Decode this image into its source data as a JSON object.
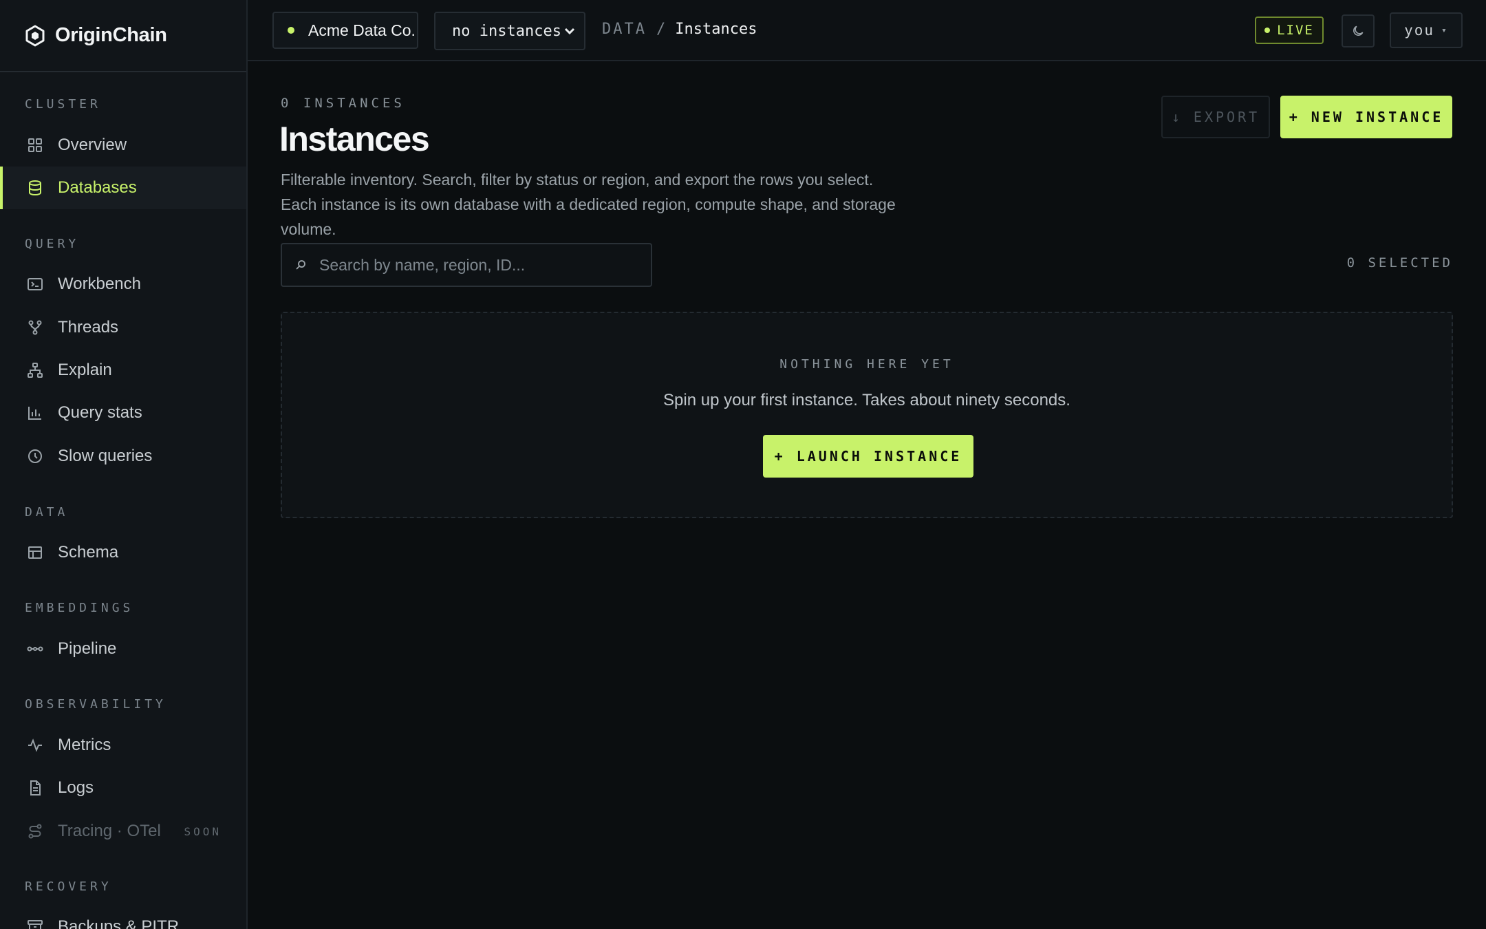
{
  "app": {
    "name": "OriginChain"
  },
  "colors": {
    "accent": "#c8f26a",
    "background": "#0b0e10",
    "sidebar": "#111519"
  },
  "sidebar": {
    "sections": [
      {
        "label": "CLUSTER",
        "items": [
          {
            "label": "Overview",
            "icon": "grid-icon"
          },
          {
            "label": "Databases",
            "icon": "database-icon",
            "active": true
          }
        ]
      },
      {
        "label": "QUERY",
        "items": [
          {
            "label": "Workbench",
            "icon": "terminal-icon"
          },
          {
            "label": "Threads",
            "icon": "branch-icon"
          },
          {
            "label": "Explain",
            "icon": "tree-icon"
          },
          {
            "label": "Query stats",
            "icon": "bar-chart-icon"
          },
          {
            "label": "Slow queries",
            "icon": "clock-icon"
          }
        ]
      },
      {
        "label": "DATA",
        "items": [
          {
            "label": "Schema",
            "icon": "table-icon"
          }
        ]
      },
      {
        "label": "EMBEDDINGS",
        "items": [
          {
            "label": "Pipeline",
            "icon": "pipeline-icon"
          }
        ]
      },
      {
        "label": "OBSERVABILITY",
        "items": [
          {
            "label": "Metrics",
            "icon": "pulse-icon"
          },
          {
            "label": "Logs",
            "icon": "document-icon"
          },
          {
            "label": "Tracing · OTel",
            "icon": "route-icon",
            "badge": "SOON",
            "disabled": true
          }
        ]
      },
      {
        "label": "RECOVERY",
        "items": [
          {
            "label": "Backups & PITR",
            "icon": "archive-icon"
          }
        ]
      }
    ]
  },
  "topbar": {
    "org": "Acme Data Co.",
    "instance_select": "no instances",
    "breadcrumb": [
      "DATA",
      "Instances"
    ],
    "breadcrumb_separator": "/",
    "live": "LIVE",
    "user": "you",
    "user_caret": "▾"
  },
  "page": {
    "count_label": "0 INSTANCES",
    "title": "Instances",
    "description": "Filterable inventory. Search, filter by status or region, and export the rows you select. Each instance is its own database with a dedicated region, compute shape, and storage volume.",
    "export_label": "↓ EXPORT",
    "new_label": "+ NEW INSTANCE",
    "search_placeholder": "Search by name, region, ID...",
    "selected_label": "0 SELECTED",
    "empty": {
      "title": "NOTHING HERE YET",
      "description": "Spin up your first instance. Takes about ninety seconds.",
      "button": "+ LAUNCH INSTANCE"
    }
  }
}
